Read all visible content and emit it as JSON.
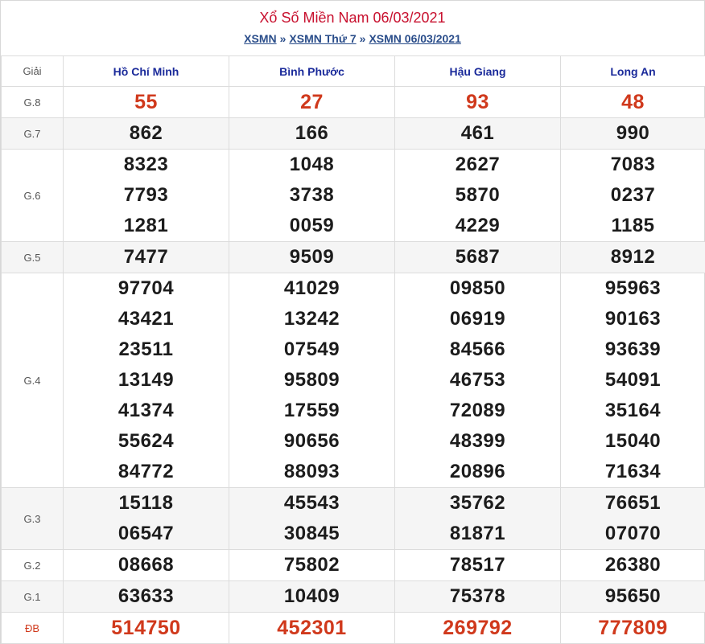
{
  "header": {
    "title": "Xổ Số Miền Nam 06/03/2021",
    "breadcrumb": [
      "XSMN",
      "XSMN Thứ 7",
      "XSMN 06/03/2021"
    ],
    "separator": "»"
  },
  "table": {
    "prize_header": "Giải",
    "provinces": [
      "Hồ Chí Minh",
      "Bình Phước",
      "Hậu Giang",
      "Long An"
    ],
    "rows": [
      {
        "label": "G.8",
        "shade": false,
        "style": "red",
        "values": [
          [
            "55"
          ],
          [
            "27"
          ],
          [
            "93"
          ],
          [
            "48"
          ]
        ]
      },
      {
        "label": "G.7",
        "shade": true,
        "style": "normal",
        "values": [
          [
            "862"
          ],
          [
            "166"
          ],
          [
            "461"
          ],
          [
            "990"
          ]
        ]
      },
      {
        "label": "G.6",
        "shade": false,
        "style": "normal",
        "values": [
          [
            "8323",
            "7793",
            "1281"
          ],
          [
            "1048",
            "3738",
            "0059"
          ],
          [
            "2627",
            "5870",
            "4229"
          ],
          [
            "7083",
            "0237",
            "1185"
          ]
        ]
      },
      {
        "label": "G.5",
        "shade": true,
        "style": "normal",
        "values": [
          [
            "7477"
          ],
          [
            "9509"
          ],
          [
            "5687"
          ],
          [
            "8912"
          ]
        ]
      },
      {
        "label": "G.4",
        "shade": false,
        "style": "normal",
        "values": [
          [
            "97704",
            "43421",
            "23511",
            "13149",
            "41374",
            "55624",
            "84772"
          ],
          [
            "41029",
            "13242",
            "07549",
            "95809",
            "17559",
            "90656",
            "88093"
          ],
          [
            "09850",
            "06919",
            "84566",
            "46753",
            "72089",
            "48399",
            "20896"
          ],
          [
            "95963",
            "90163",
            "93639",
            "54091",
            "35164",
            "15040",
            "71634"
          ]
        ]
      },
      {
        "label": "G.3",
        "shade": true,
        "style": "normal",
        "values": [
          [
            "15118",
            "06547"
          ],
          [
            "45543",
            "30845"
          ],
          [
            "35762",
            "81871"
          ],
          [
            "76651",
            "07070"
          ]
        ]
      },
      {
        "label": "G.2",
        "shade": false,
        "style": "normal",
        "values": [
          [
            "08668"
          ],
          [
            "75802"
          ],
          [
            "78517"
          ],
          [
            "26380"
          ]
        ]
      },
      {
        "label": "G.1",
        "shade": true,
        "style": "normal",
        "values": [
          [
            "63633"
          ],
          [
            "10409"
          ],
          [
            "75378"
          ],
          [
            "95650"
          ]
        ]
      },
      {
        "label": "ĐB",
        "shade": false,
        "style": "red",
        "values": [
          [
            "514750"
          ],
          [
            "452301"
          ],
          [
            "269792"
          ],
          [
            "777809"
          ]
        ]
      }
    ]
  },
  "colors": {
    "title": "#c8102e",
    "link": "#2a4d8a",
    "province": "#1a2a9a",
    "highlight": "#d0391c",
    "shade": "#f5f5f5"
  }
}
